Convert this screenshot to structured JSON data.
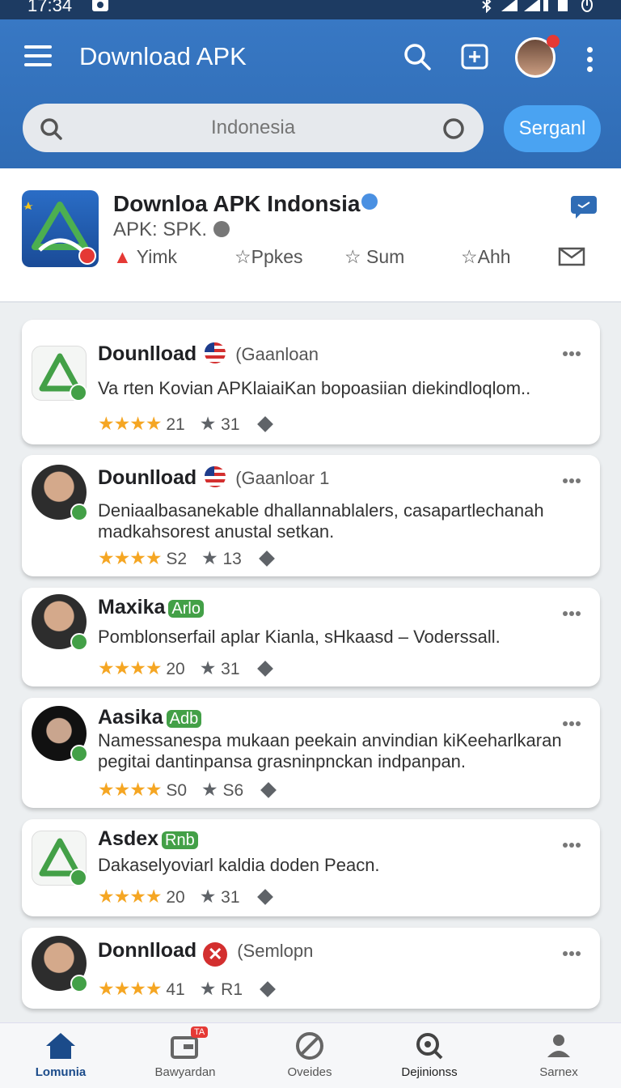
{
  "status_bar": {
    "time": "17:34"
  },
  "header": {
    "title": "Download APK",
    "search_placeholder": "Indonesia",
    "search_button": "Serganl",
    "icons": [
      "menu-icon",
      "search-icon",
      "add-box-icon",
      "profile-avatar",
      "more-vert-icon"
    ]
  },
  "app": {
    "name": "Downloa APK Indonsia",
    "subtitle": "APK: SPK.",
    "stats": [
      "Yimk",
      "Ppkes",
      "Sum",
      "Ahh"
    ]
  },
  "cards": [
    {
      "title": "Dounlload",
      "tag": "(Gaanloan",
      "desc": "Va rten Kovian APKlaiaiKan bopoasiian diekindloqlom..",
      "rating": "21",
      "count": "31",
      "stars": "★★★★"
    },
    {
      "title": "Dounlload",
      "tag": "(Gaanloar 1",
      "desc": "Deniaalbasanekable dhallannablalers, casapartlechanah madkahsorest anustal setkan.",
      "rating": "S2",
      "count": "13",
      "stars": "★★★★"
    },
    {
      "title": "Maxika",
      "tag": "Arlo",
      "desc": "Pomblonserfail aplar Kianla, sHkaasd – Voderssall.",
      "rating": "20",
      "count": "31",
      "stars": "★★★★"
    },
    {
      "title": "Aasika",
      "tag": "Adb",
      "desc": "Namessanespa mukaan peekain anvindian kiKeeharlkaran pegitai dantinpansa grasninpnckan indpanpan.",
      "rating": "S0",
      "count": "S6",
      "stars": "★★★★"
    },
    {
      "title": "Asdex",
      "tag": "Rnb",
      "desc": "Dakaselyoviarl kaldia doden Peacn.",
      "rating": "20",
      "count": "31",
      "stars": "★★★★"
    },
    {
      "title": "Donnlload",
      "tag": "(Semlopn",
      "desc": "",
      "rating": "41",
      "count": "R1",
      "stars": "★★★★"
    }
  ],
  "bottom_nav": {
    "items": [
      "Lomunia",
      "Bawyardan",
      "Oveides",
      "Dejinionss",
      "Sarnex"
    ],
    "badge": "TA"
  },
  "colors": {
    "primary": "#3373bd",
    "accent": "#4aa3f2",
    "star": "#f5a623"
  }
}
